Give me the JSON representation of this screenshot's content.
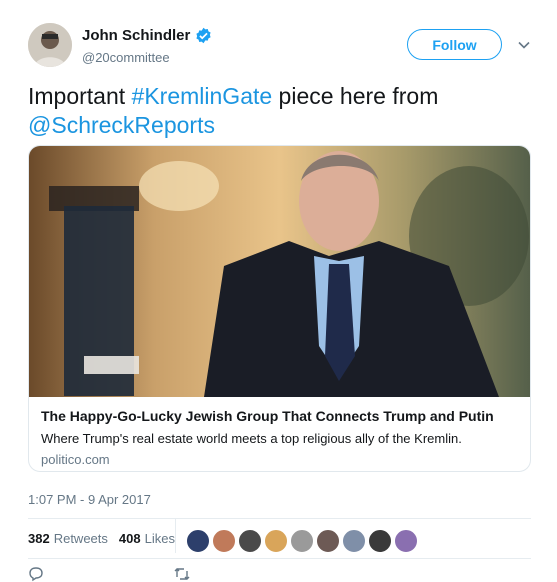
{
  "user": {
    "name": "John Schindler",
    "handle": "@20committee",
    "verified": true
  },
  "follow_button": {
    "label": "Follow"
  },
  "tweet": {
    "text_prefix": "Important ",
    "hashtag": "#KremlinGate",
    "text_middle": " piece here from",
    "mention": "@SchreckReports"
  },
  "card": {
    "title": "The Happy-Go-Lucky Jewish Group That Connects Trump and Putin",
    "description": "Where Trump's real estate world meets a top religious ally of the Kremlin.",
    "domain": "politico.com"
  },
  "timestamp": "1:07 PM - 9 Apr 2017",
  "stats": {
    "retweets_count": "382",
    "retweets_label": "Retweets",
    "likes_count": "408",
    "likes_label": "Likes"
  },
  "colors": {
    "accent": "#1da1f2",
    "link": "#1b95e0",
    "muted": "#657786"
  },
  "icons": [
    "verified-badge-icon",
    "chevron-down-icon",
    "reply-icon",
    "retweet-icon"
  ],
  "likers": [
    {
      "color": "#2d3f6b"
    },
    {
      "color": "#c07a5a"
    },
    {
      "color": "#4a4a4a"
    },
    {
      "color": "#d9a55a"
    },
    {
      "color": "#9a9a9a"
    },
    {
      "color": "#6d5a55"
    },
    {
      "color": "#7f8fa8"
    },
    {
      "color": "#3a3a3a"
    },
    {
      "color": "#8a6fb0"
    }
  ]
}
